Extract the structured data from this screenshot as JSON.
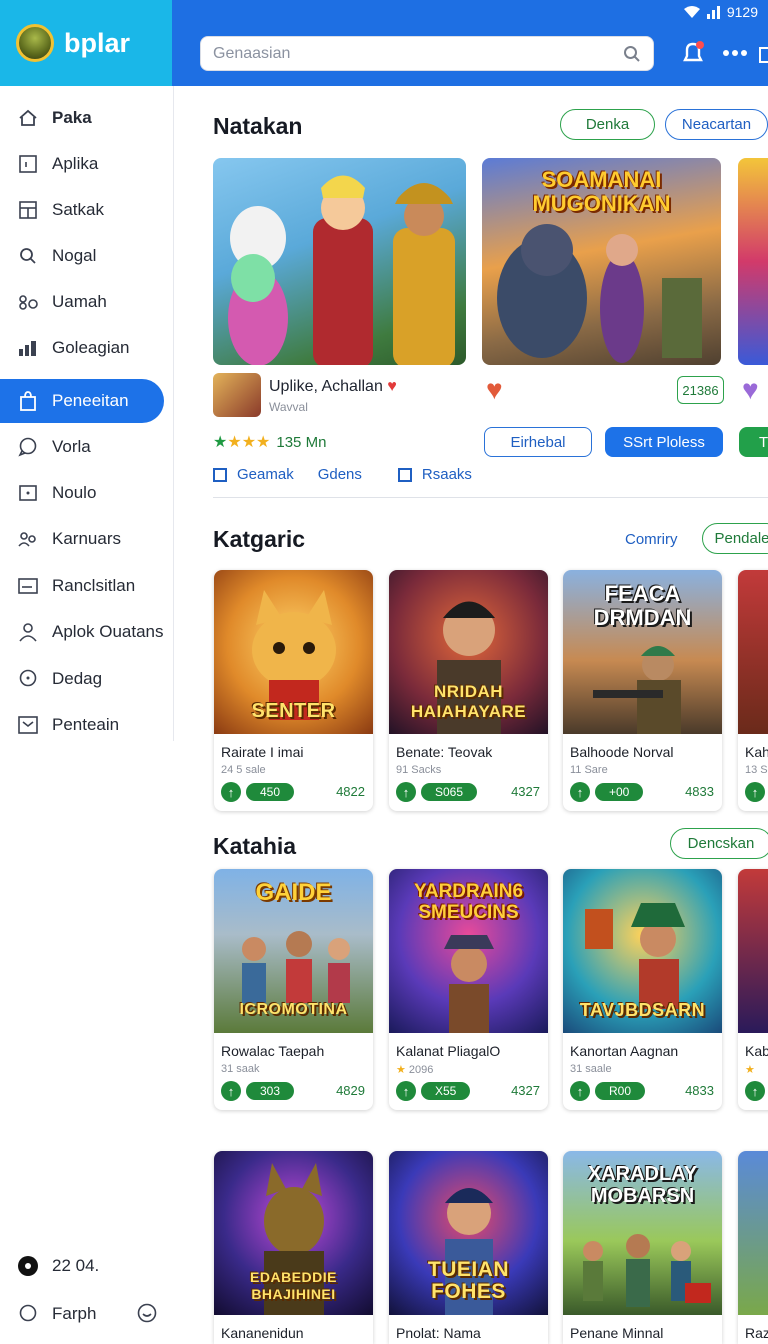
{
  "app": {
    "brand": "bplar"
  },
  "status": {
    "time": "9129"
  },
  "search": {
    "placeholder": "Genaasian"
  },
  "sidebar": {
    "items": [
      {
        "label": "Paka",
        "icon": "home-icon"
      },
      {
        "label": "Aplika",
        "icon": "square-icon"
      },
      {
        "label": "Satkak",
        "icon": "grid-icon"
      },
      {
        "label": "Nogal",
        "icon": "search-icon"
      },
      {
        "label": "Uamah",
        "icon": "link-icon"
      },
      {
        "label": "Goleagian",
        "icon": "chart-icon"
      },
      {
        "label": "Peneeitan",
        "icon": "bag-icon"
      },
      {
        "label": "Vorla",
        "icon": "chat-icon"
      },
      {
        "label": "Noulo",
        "icon": "square-icon"
      },
      {
        "label": "Karnuars",
        "icon": "people-icon"
      },
      {
        "label": "Ranclsitlan",
        "icon": "card-icon"
      },
      {
        "label": "Aplok Ouatans",
        "icon": "person-icon"
      },
      {
        "label": "Dedag",
        "icon": "chat-icon"
      },
      {
        "label": "Penteain",
        "icon": "inbox-icon"
      }
    ],
    "footer": {
      "version": "22 04.",
      "account": "Farph"
    }
  },
  "featured": {
    "title": "Natakan",
    "buttons": [
      "Denka",
      "Neacartan"
    ],
    "main_title": "Uplike, Achallan",
    "main_sub": "Wavval",
    "rating_text": "135 Mn",
    "rating": 4,
    "links": [
      "Geamak",
      "Gdens",
      "Rsaaks"
    ],
    "second_banner": "SOAMANAI MUGONIKAN",
    "second_badge": "21386",
    "second_buttons": [
      "Eirhebal",
      "SSrt Ploless"
    ],
    "third_button": "T"
  },
  "sections": [
    {
      "title": "Katgaric",
      "actions": [
        "Comriry",
        "Pendale"
      ],
      "cards": [
        {
          "art_top": "",
          "art_label": "SENTER",
          "name": "Rairate I imai",
          "sub": "24 5 sale",
          "price": "450",
          "score": "4822"
        },
        {
          "art_top": "",
          "art_label": "NRIDAH HAIAHAYARE",
          "name": "Benate: Teovak",
          "sub": "91 Sacks",
          "price": "S065",
          "score": "4327"
        },
        {
          "art_top": "FEACA DRMDAN",
          "art_label": "",
          "name": "Balhoode Norval",
          "sub": "11 Sare",
          "price": "+00",
          "score": "4833"
        },
        {
          "art_top": "",
          "art_label": "",
          "name": "Kah",
          "sub": "13 S",
          "price": "",
          "score": ""
        }
      ]
    },
    {
      "title": "Katahia",
      "actions": [
        "Dencskan"
      ],
      "cards": [
        {
          "art_top": "GAIDE",
          "art_label": "ICROMOTINA",
          "name": "Rowalac Taepah",
          "sub": "31 saak",
          "price": "303",
          "score": "4829"
        },
        {
          "art_top": "YARDRAIN6 SMEUCINS",
          "art_label": "",
          "name": "Kalanat PliagalO",
          "sub": "2096",
          "price": "X55",
          "score": "4327"
        },
        {
          "art_top": "",
          "art_label": "TAVJBDSARN",
          "name": "Kanortan Aagnan",
          "sub": "31 saale",
          "price": "R00",
          "score": "4833"
        },
        {
          "art_top": "",
          "art_label": "",
          "name": "Kab",
          "sub": "",
          "price": "",
          "score": ""
        }
      ]
    },
    {
      "title": "",
      "actions": [],
      "cards": [
        {
          "art_top": "",
          "art_label": "EDABEDDIE BHAJIHINEI",
          "name": "Kananenidun",
          "sub": "",
          "price": "",
          "score": ""
        },
        {
          "art_top": "",
          "art_label": "TUEIAN FOHES",
          "name": "Pnolat: Nama",
          "sub": "",
          "price": "",
          "score": ""
        },
        {
          "art_top": "XARADLAY MOBARSN",
          "art_label": "",
          "name": "Penane Minnal",
          "sub": "",
          "price": "",
          "score": ""
        },
        {
          "art_top": "",
          "art_label": "",
          "name": "Raz",
          "sub": "",
          "price": "",
          "score": ""
        }
      ]
    }
  ]
}
